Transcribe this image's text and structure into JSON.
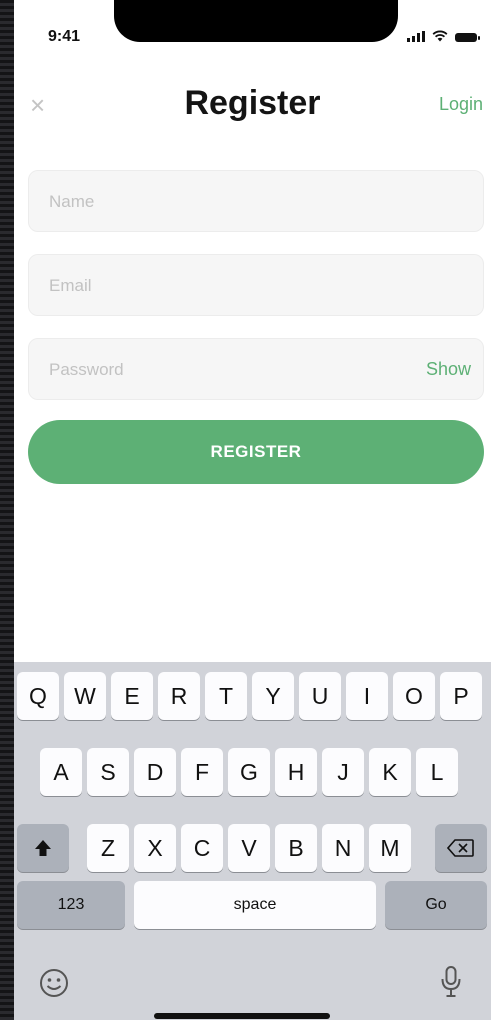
{
  "status_bar": {
    "time": "9:41"
  },
  "header": {
    "close_symbol": "×",
    "title": "Register",
    "login_label": "Login"
  },
  "form": {
    "name": {
      "placeholder": "Name",
      "value": ""
    },
    "email": {
      "placeholder": "Email",
      "value": ""
    },
    "password": {
      "placeholder": "Password",
      "value": "",
      "show_label": "Show"
    },
    "register_label": "REGISTER"
  },
  "keyboard": {
    "row1": [
      "Q",
      "W",
      "E",
      "R",
      "T",
      "Y",
      "U",
      "I",
      "O",
      "P"
    ],
    "row2": [
      "A",
      "S",
      "D",
      "F",
      "G",
      "H",
      "J",
      "K",
      "L"
    ],
    "row3": [
      "Z",
      "X",
      "C",
      "V",
      "B",
      "N",
      "M"
    ],
    "numbers_label": "123",
    "space_label": "space",
    "go_label": "Go",
    "shift_icon": "shift-icon",
    "backspace_icon": "backspace-icon",
    "emoji_icon": "emoji-icon",
    "mic_icon": "microphone-icon"
  },
  "colors": {
    "accent": "#5db075",
    "field_bg": "#f6f6f6",
    "keyboard_bg": "#d1d3d9",
    "function_key": "#acb1ba"
  }
}
